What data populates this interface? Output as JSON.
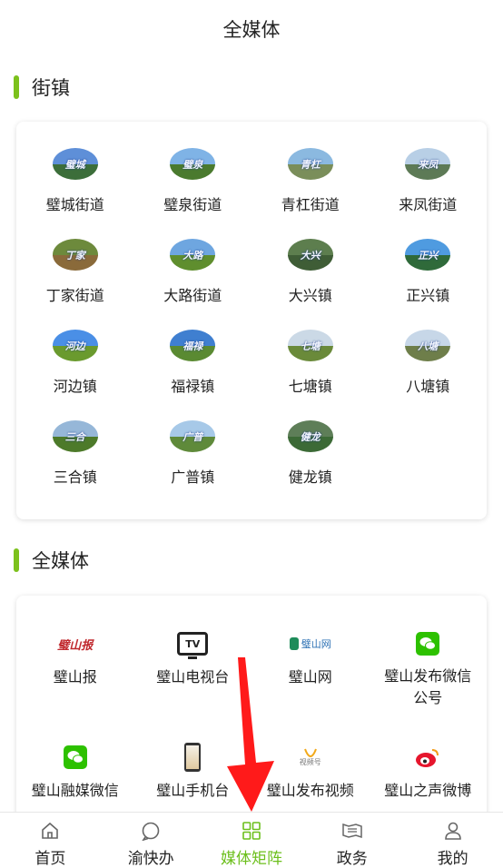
{
  "header": {
    "title": "全媒体"
  },
  "sections": {
    "towns": {
      "label": "街镇"
    },
    "media": {
      "label": "全媒体"
    }
  },
  "towns": [
    {
      "name": "璧城街道",
      "cap": "璧城",
      "sky": "#5e8fd8",
      "ground": "#3c6e3a"
    },
    {
      "name": "璧泉街道",
      "cap": "璧泉",
      "sky": "#7fb3e6",
      "ground": "#4a7a2e"
    },
    {
      "name": "青杠街道",
      "cap": "青杠",
      "sky": "#8bb9e0",
      "ground": "#7a8e5a"
    },
    {
      "name": "来凤街道",
      "cap": "来凤",
      "sky": "#b8cfe6",
      "ground": "#5d7a56"
    },
    {
      "name": "丁家街道",
      "cap": "丁家",
      "sky": "#6d8a3c",
      "ground": "#8a6a3a"
    },
    {
      "name": "大路街道",
      "cap": "大路",
      "sky": "#6ea6e0",
      "ground": "#5f8e2e"
    },
    {
      "name": "大兴镇",
      "cap": "大兴",
      "sky": "#5d7e4e",
      "ground": "#3f5d36"
    },
    {
      "name": "正兴镇",
      "cap": "正兴",
      "sky": "#4f9be0",
      "ground": "#2f6a3a"
    },
    {
      "name": "河边镇",
      "cap": "河边",
      "sky": "#4a8fe6",
      "ground": "#6a9a2e"
    },
    {
      "name": "福禄镇",
      "cap": "福禄",
      "sky": "#3f7fd0",
      "ground": "#5a8a32"
    },
    {
      "name": "七塘镇",
      "cap": "七塘",
      "sky": "#cbd9e6",
      "ground": "#6a8a3a"
    },
    {
      "name": "八塘镇",
      "cap": "八塘",
      "sky": "#c7d7e8",
      "ground": "#6e7e4a"
    },
    {
      "name": "三合镇",
      "cap": "三合",
      "sky": "#96b7d8",
      "ground": "#4d7a2a"
    },
    {
      "name": "广普镇",
      "cap": "广普",
      "sky": "#a7c9e8",
      "ground": "#5f8a3a"
    },
    {
      "name": "健龙镇",
      "cap": "健龙",
      "sky": "#5e7e58",
      "ground": "#3c6a36"
    }
  ],
  "media": [
    {
      "name": "璧山报",
      "icon": "newspaper-logo-icon",
      "logo_text": "璧山报"
    },
    {
      "name": "璧山电视台",
      "icon": "tv-icon",
      "logo_text": "TV"
    },
    {
      "name": "璧山网",
      "icon": "bishan-net-logo-icon",
      "logo_text": "璧山网"
    },
    {
      "name": "璧山发布微信公号",
      "icon": "wechat-icon"
    },
    {
      "name": "璧山融媒微信",
      "icon": "wechat-icon"
    },
    {
      "name": "璧山手机台",
      "icon": "phone-icon"
    },
    {
      "name": "璧山发布视频",
      "icon": "video-channel-icon",
      "logo_text": "视频号"
    },
    {
      "name": "璧山之声微博",
      "icon": "weibo-icon"
    }
  ],
  "tabs": [
    {
      "label": "首页",
      "icon": "home-icon",
      "active": false
    },
    {
      "label": "渝快办",
      "icon": "chat-bubble-icon",
      "active": false
    },
    {
      "label": "媒体矩阵",
      "icon": "grid-icon",
      "active": true
    },
    {
      "label": "政务",
      "icon": "newspaper-icon",
      "active": false
    },
    {
      "label": "我的",
      "icon": "user-icon",
      "active": false
    }
  ],
  "colors": {
    "accent": "#7cc11c",
    "active_tab": "#6cbf1c",
    "arrow": "#ff1a1a",
    "wechat": "#2dc100",
    "weibo": "#e6162d"
  }
}
